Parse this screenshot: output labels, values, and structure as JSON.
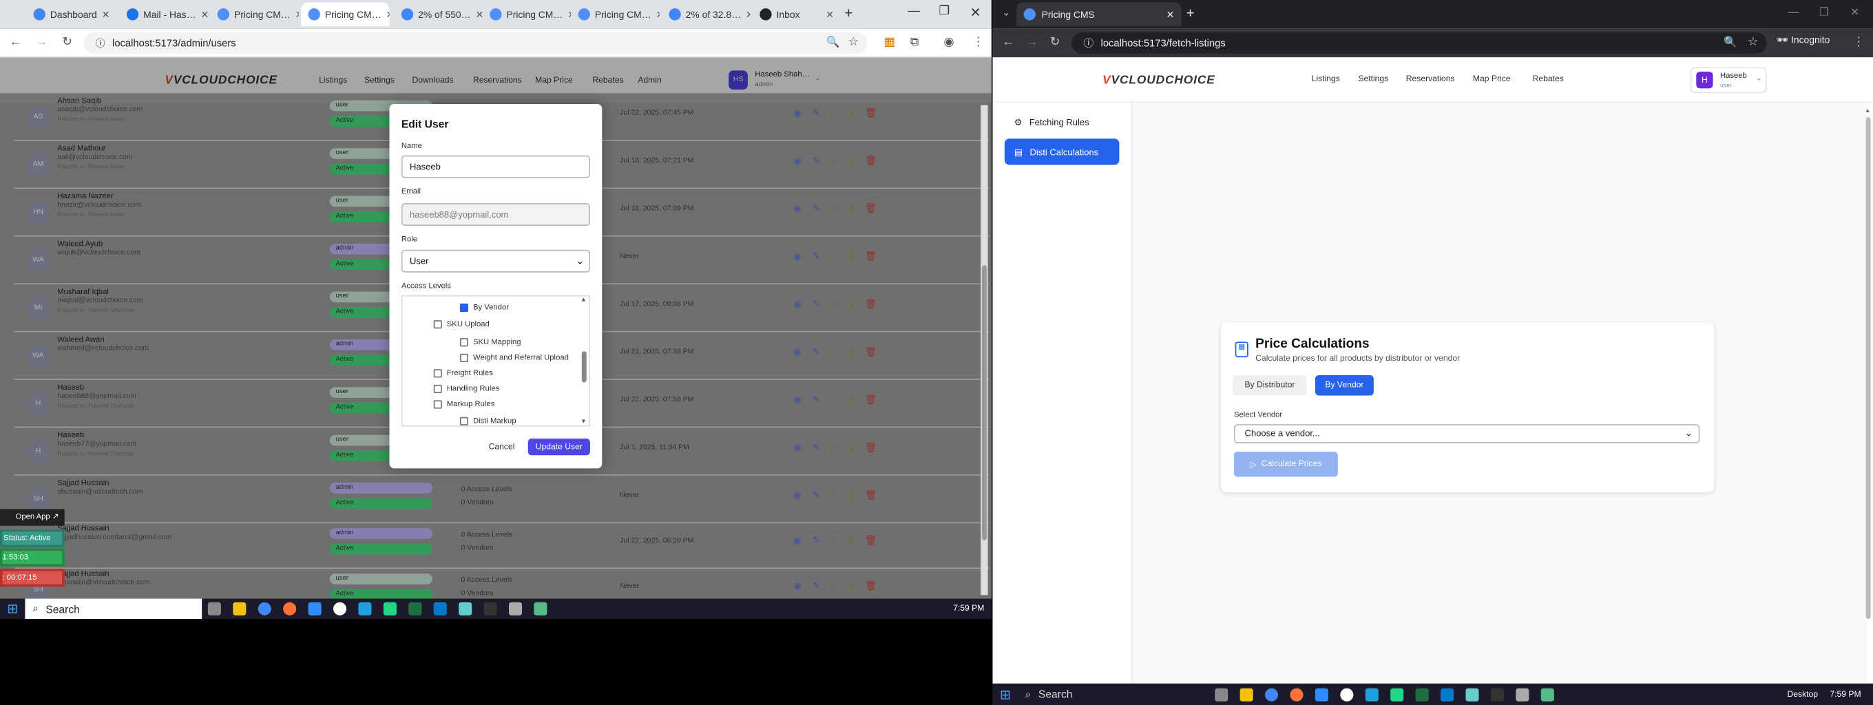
{
  "left": {
    "tabs": [
      "Dashboard",
      "Mail - Has…",
      "Pricing CM…",
      "Pricing CM…",
      "2% of 550…",
      "Pricing CM…",
      "Pricing CM…",
      "2% of 32.8…",
      "Inbox"
    ],
    "url": "localhost:5173/admin/users",
    "brand": "VCLOUDCHOICE",
    "nav": [
      "Listings",
      "Settings",
      "Downloads",
      "Reservations",
      "Map Price",
      "Rebates",
      "Admin"
    ],
    "user": {
      "initials": "HS",
      "name": "Haseeb Shah…",
      "role": "admin"
    },
    "rows": [
      {
        "initials": "AS",
        "name": "Ahsan Saqib",
        "email": "asaqib@vcloudchoice.com",
        "reports": "Reports to: Waleed Awan",
        "role": "user",
        "status": "Active",
        "date": "Jul 22, 2025, 07:45 PM"
      },
      {
        "initials": "AM",
        "name": "Asad Mathour",
        "email": "aali@vcloudchoice.com",
        "reports": "Reports to: Waleed Awan",
        "role": "user",
        "status": "Active",
        "date": "Jul 18, 2025, 07:21 PM"
      },
      {
        "initials": "HN",
        "name": "Hazama Nazeer",
        "email": "hnazir@vcloudchoice.com",
        "reports": "Reports to: Waleed Awan",
        "role": "user",
        "status": "Active",
        "date": "Jul 18, 2025, 07:09 PM"
      },
      {
        "initials": "WA",
        "name": "Waleed Ayub",
        "email": "wajub@vcloudchoice.com",
        "reports": "",
        "role": "admin",
        "status": "Active",
        "date": "Never"
      },
      {
        "initials": "MI",
        "name": "Musharaf Iqbal",
        "email": "miqbal@vcloudchoice.com",
        "reports": "Reports to: Haseeb Shahzad",
        "role": "user",
        "status": "Active",
        "date": "Jul 17, 2025, 09:08 PM"
      },
      {
        "initials": "WA",
        "name": "Waleed Awan",
        "email": "wahmed@vcloudchoice.com",
        "reports": "",
        "role": "admin",
        "status": "Active",
        "date": "Jul 21, 2025, 07:38 PM"
      },
      {
        "initials": "H",
        "name": "Haseeb",
        "email": "haseeb88@yopmail.com",
        "reports": "Reports to: Haseeb Shahzad",
        "role": "user",
        "status": "Active",
        "date": "Jul 22, 2025, 07:58 PM"
      },
      {
        "initials": "H",
        "name": "Haseeb",
        "email": "haseeb77@yopmail.com",
        "reports": "Reports to: Haseeb Shahzad",
        "role": "user",
        "status": "Active",
        "date": "Jul 1, 2025, 11:04 PM"
      },
      {
        "initials": "SH",
        "name": "Sajjad Hussain",
        "email": "shussain@vcloudtech.com",
        "reports": "",
        "role": "admin",
        "status": "Active",
        "date": "Never",
        "access": "0 Access Levels",
        "vendors": "0 Vendors"
      },
      {
        "initials": "SH",
        "name": "Sajjad Hussain",
        "email": "sajjadhussain.comtanix@gmail.com",
        "reports": "",
        "role": "admin",
        "status": "Active",
        "date": "Jul 22, 2025, 06:20 PM",
        "access": "0 Access Levels",
        "vendors": "0 Vendors"
      },
      {
        "initials": "SH",
        "name": "Sajjad Hussain",
        "email": "shussain@vcloudchoice.com",
        "reports": "",
        "role": "user",
        "status": "Active",
        "date": "Never",
        "access": "0 Access Levels",
        "vendors": "0 Vendors"
      }
    ],
    "modal": {
      "title": "Edit User",
      "name_label": "Name",
      "name_value": "Haseeb",
      "email_label": "Email",
      "email_value": "haseeb88@yopmail.com",
      "role_label": "Role",
      "role_value": "User",
      "access_label": "Access Levels",
      "items": [
        {
          "label": "By Vendor",
          "checked": true,
          "indent": 1
        },
        {
          "label": "SKU Upload",
          "checked": false,
          "indent": 0
        },
        {
          "label": "SKU Mapping",
          "checked": false,
          "indent": 1
        },
        {
          "label": "Weight and Referral Upload",
          "checked": false,
          "indent": 1
        },
        {
          "label": "Freight Rules",
          "checked": false,
          "indent": 0
        },
        {
          "label": "Handling Rules",
          "checked": false,
          "indent": 0
        },
        {
          "label": "Markup Rules",
          "checked": false,
          "indent": 0
        },
        {
          "label": "Disti Markup",
          "checked": false,
          "indent": 1
        }
      ],
      "cancel": "Cancel",
      "update": "Update User"
    },
    "overlay": {
      "open_app": "Open App ↗",
      "status": "Status: Active",
      "time1": "1:53:03",
      "time2": ": 00:07:15"
    },
    "taskbar": {
      "search": "Search",
      "clock": "7:59 PM"
    }
  },
  "right": {
    "tab": "Pricing CMS",
    "url": "localhost:5173/fetch-listings",
    "incognito": "Incognito",
    "brand": "VCLOUDCHOICE",
    "nav": [
      "Listings",
      "Settings",
      "Reservations",
      "Map Price",
      "Rebates"
    ],
    "user": {
      "initial": "H",
      "name": "Haseeb",
      "role": "user"
    },
    "sidebar": [
      "Fetching Rules",
      "Disti Calculations"
    ],
    "card": {
      "title": "Price Calculations",
      "subtitle": "Calculate prices for all products by distributor or vendor",
      "tab1": "By Distributor",
      "tab2": "By Vendor",
      "select_label": "Select Vendor",
      "select_value": "Choose a vendor...",
      "button": "Calculate Prices"
    },
    "taskbar": {
      "search": "Search",
      "desktop": "Desktop",
      "clock": "7:59 PM"
    }
  },
  "colors": {
    "accent": "#2563eb",
    "purple": "#4f46e5",
    "active_green": "#4ade80",
    "admin_purple": "#c4b5fd"
  }
}
